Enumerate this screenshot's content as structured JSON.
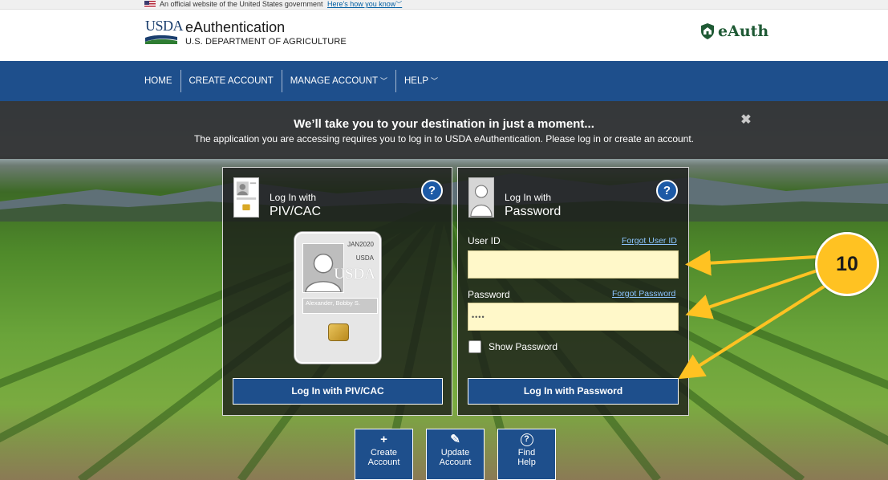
{
  "gov_banner": {
    "text": "An official website of the United States government",
    "link": "Here's how you know"
  },
  "header": {
    "logo_text": "USDA",
    "title": "eAuthentication",
    "subtitle": "U.S. DEPARTMENT OF AGRICULTURE",
    "right_logo": "eAuth"
  },
  "nav": {
    "items": [
      {
        "label": "HOME"
      },
      {
        "label": "CREATE ACCOUNT"
      },
      {
        "label": "MANAGE ACCOUNT"
      },
      {
        "label": "HELP"
      }
    ]
  },
  "notice": {
    "title": "We’ll take you to your destination in just a moment...",
    "message": "The application you are accessing requires you to log in to USDA eAuthentication. Please log in or create an account.",
    "close": "✖"
  },
  "piv_panel": {
    "heading_line1": "Log In with",
    "heading_line2": "PIV/CAC",
    "help": "?",
    "card": {
      "date": "JAN2020",
      "agency": "USDA",
      "logo": "USDA",
      "name": "Alexander, Bobby S."
    },
    "button": "Log In with PIV/CAC"
  },
  "password_panel": {
    "heading_line1": "Log In with",
    "heading_line2": "Password",
    "help": "?",
    "user_id_label": "User ID",
    "forgot_user_id": "Forgot User ID",
    "user_id_value": "",
    "password_label": "Password",
    "forgot_password": "Forgot Password",
    "password_value": "••••",
    "show_password_label": "Show Password",
    "button": "Log In with Password"
  },
  "quick_actions": [
    {
      "icon": "+",
      "line1": "Create",
      "line2": "Account"
    },
    {
      "icon": "✎",
      "line1": "Update",
      "line2": "Account"
    },
    {
      "icon": "?",
      "line1": "Find",
      "line2": "Help"
    }
  ],
  "annotation": {
    "number": "10",
    "color": "#ffc222"
  },
  "colors": {
    "nav_blue": "#1e4f8c",
    "help_blue": "#1d5aa6",
    "field_yellow": "#fff8c9",
    "link_blue": "#8cc4ff"
  }
}
